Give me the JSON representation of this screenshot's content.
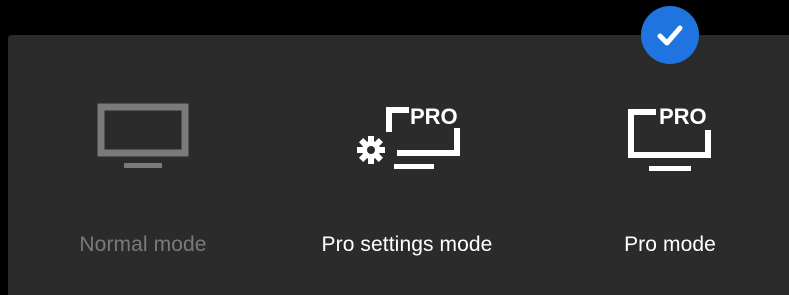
{
  "modes": [
    {
      "label": "Normal mode",
      "icon": "monitor-icon",
      "selected": false
    },
    {
      "label": "Pro settings mode",
      "icon": "monitor-pro-settings-icon",
      "badge": "PRO",
      "selected": false
    },
    {
      "label": "Pro mode",
      "icon": "monitor-pro-icon",
      "badge": "PRO",
      "selected": true
    }
  ],
  "selected_indicator": {
    "icon": "checkmark-icon",
    "color": "#1f74e0"
  },
  "colors": {
    "background": "#000000",
    "panel": "#2b2b2b",
    "disabled_text": "#7a7a7a",
    "text": "#ffffff",
    "accent": "#1f74e0"
  }
}
